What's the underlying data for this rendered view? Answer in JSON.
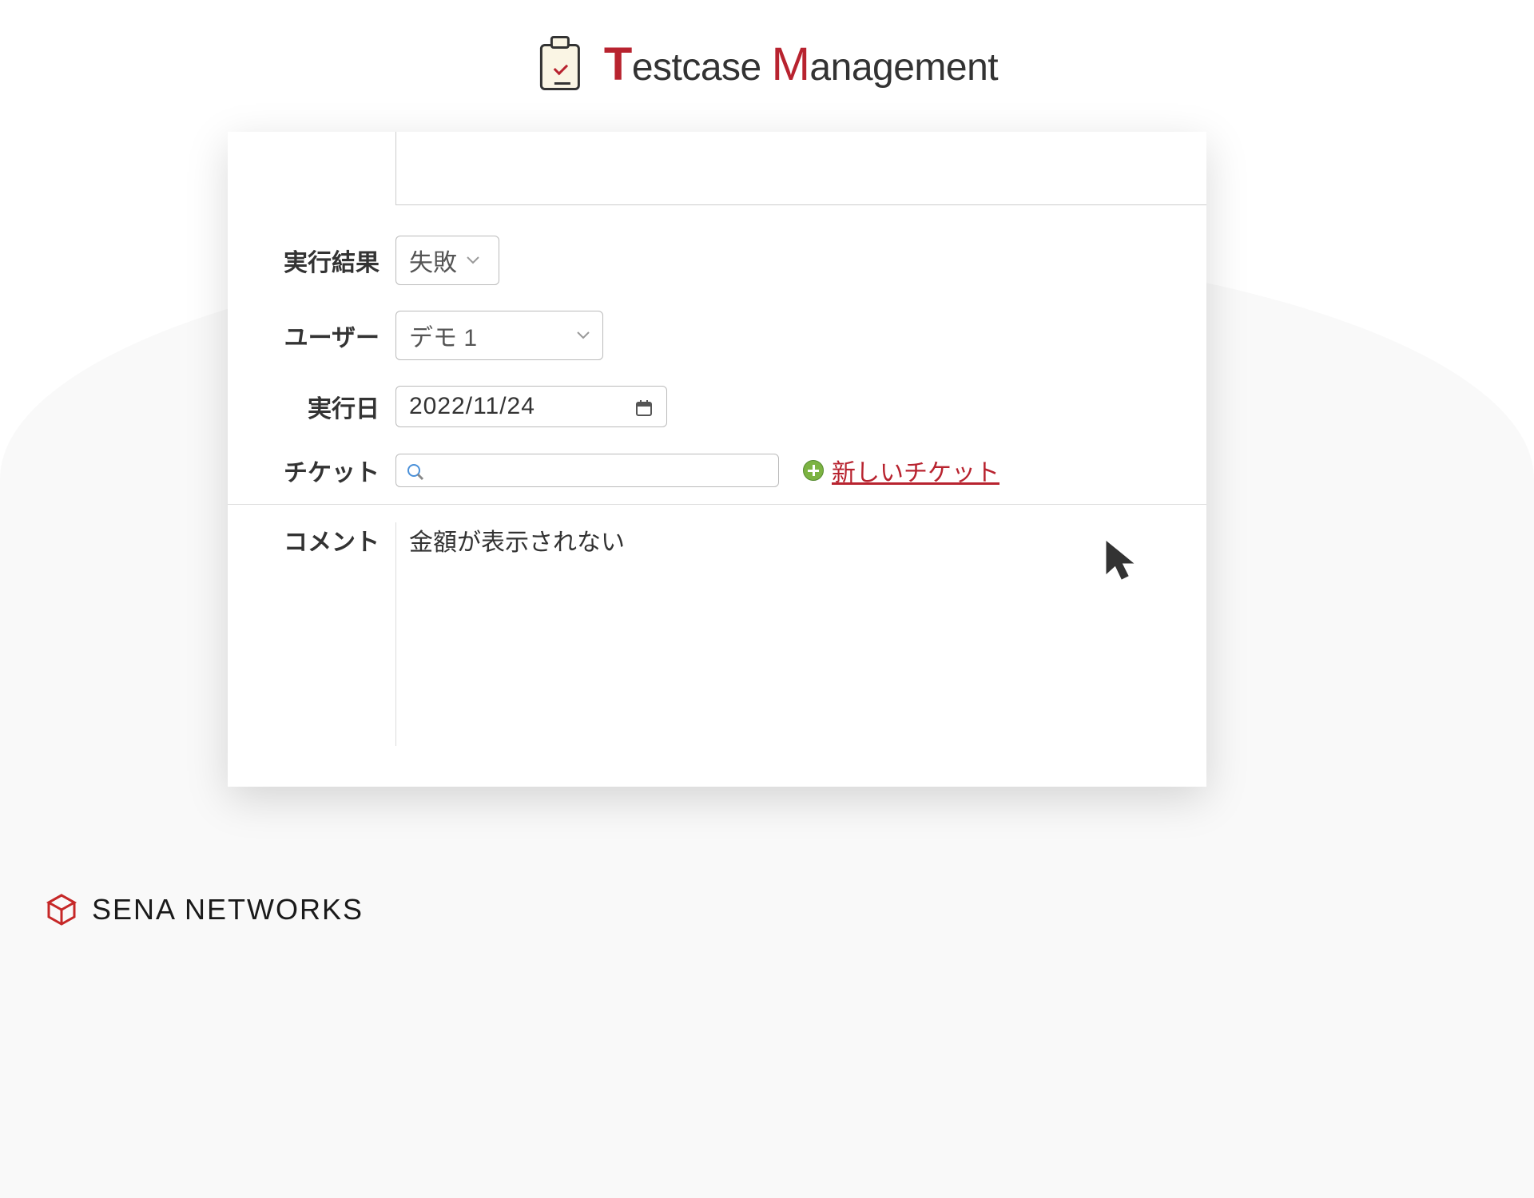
{
  "header": {
    "title_part1": "estcase ",
    "title_part2": "anagement"
  },
  "form": {
    "result": {
      "label": "実行結果",
      "value": "失敗"
    },
    "user": {
      "label": "ユーザー",
      "value": "デモ 1"
    },
    "exec_date": {
      "label": "実行日",
      "value": "2022/11/24"
    },
    "ticket": {
      "label": "チケット",
      "new_link": "新しいチケット"
    },
    "comment": {
      "label": "コメント",
      "value": "金額が表示されない"
    }
  },
  "footer": {
    "company": "SENA NETWORKS"
  }
}
